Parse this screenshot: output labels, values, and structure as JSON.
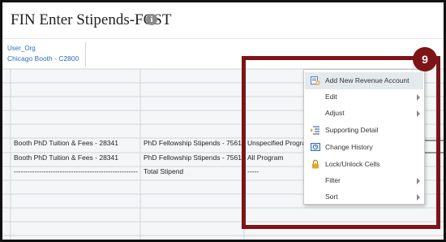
{
  "header": {
    "title": "FIN Enter Stipends-FCST",
    "info_icon": "info-icon"
  },
  "pov": {
    "label": "User_Org",
    "value": "Chicago Booth - C2800"
  },
  "grid": {
    "rows": [
      [
        "Booth PhD Tuition & Fees - 28341",
        "PhD Fellowship Stipends - 75615",
        "Unspecified Program"
      ],
      [
        "Booth PhD Tuition & Fees - 28341",
        "PhD Fellowship Stipends - 75615",
        "All Program"
      ],
      [
        "------------------------------------------------------",
        "Total Stipend",
        "-----"
      ]
    ]
  },
  "context_menu": {
    "items": [
      {
        "label": "Add New Revenue Account",
        "icon": "add-account-icon",
        "submenu": false,
        "highlighted": true
      },
      {
        "label": "Edit",
        "icon": "",
        "submenu": true,
        "highlighted": false
      },
      {
        "label": "Adjust",
        "icon": "",
        "submenu": true,
        "highlighted": false
      },
      {
        "label": "Supporting Detail",
        "icon": "supporting-detail-icon",
        "submenu": false,
        "highlighted": false
      },
      {
        "label": "Change History",
        "icon": "change-history-icon",
        "submenu": false,
        "highlighted": false
      },
      {
        "label": "Lock/Unlock Cells",
        "icon": "lock-icon",
        "submenu": false,
        "highlighted": false
      },
      {
        "label": "Filter",
        "icon": "",
        "submenu": true,
        "highlighted": false
      },
      {
        "label": "Sort",
        "icon": "",
        "submenu": true,
        "highlighted": false
      }
    ]
  },
  "callout": {
    "number": "9",
    "color": "#7d1416"
  },
  "colors": {
    "link": "#2a6ebb",
    "menu_highlight": "#e4e9ee",
    "grid_background": "#f4f6f7"
  }
}
